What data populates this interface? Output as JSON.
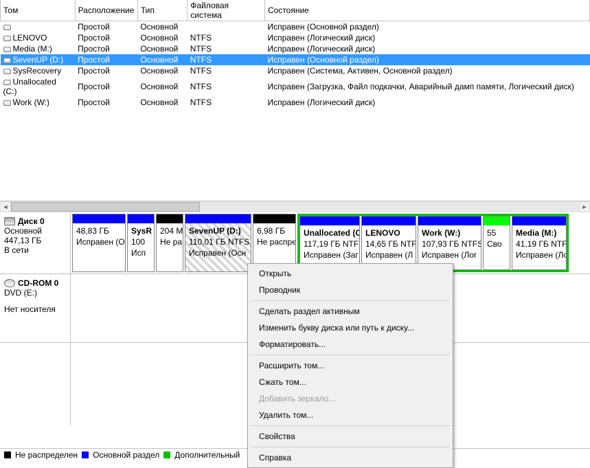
{
  "columns": [
    "Том",
    "Расположение",
    "Тип",
    "Файловая система",
    "Состояние"
  ],
  "volumes": [
    {
      "name": "",
      "layout": "Простой",
      "type": "Основной",
      "fs": "",
      "status": "Исправен (Основной раздел)",
      "sel": false
    },
    {
      "name": "LENOVO",
      "layout": "Простой",
      "type": "Основной",
      "fs": "NTFS",
      "status": "Исправен (Логический диск)",
      "sel": false
    },
    {
      "name": "Media (M:)",
      "layout": "Простой",
      "type": "Основной",
      "fs": "NTFS",
      "status": "Исправен (Логический диск)",
      "sel": false
    },
    {
      "name": "SevenUP (D:)",
      "layout": "Простой",
      "type": "Основной",
      "fs": "NTFS",
      "status": "Исправен (Основной раздел)",
      "sel": true
    },
    {
      "name": "SysRecovery",
      "layout": "Простой",
      "type": "Основной",
      "fs": "NTFS",
      "status": "Исправен (Система, Активен, Основной раздел)",
      "sel": false
    },
    {
      "name": "Unallocated (C:)",
      "layout": "Простой",
      "type": "Основной",
      "fs": "NTFS",
      "status": "Исправен (Загрузка, Файл подкачки, Аварийный дамп памяти, Логический диск)",
      "sel": false
    },
    {
      "name": "Work (W:)",
      "layout": "Простой",
      "type": "Основной",
      "fs": "NTFS",
      "status": "Исправен (Логический диск)",
      "sel": false
    }
  ],
  "disk0": {
    "title": "Диск 0",
    "type": "Основной",
    "size": "447,13 ГБ",
    "state": "В сети",
    "primaries": [
      {
        "w": 78,
        "cap": "#0000ff",
        "title": "",
        "size": "48,83 ГБ",
        "status": "Исправен (Ос"
      },
      {
        "w": 40,
        "cap": "#0000ff",
        "title": "SysR",
        "size": "100",
        "status": "Исп"
      },
      {
        "w": 40,
        "cap": "#000000",
        "title": "",
        "size": "204 М",
        "status": "Не ра"
      },
      {
        "w": 97,
        "cap": "#0000ff",
        "title": "SevenUP  (D:)",
        "size": "110,01 ГБ NTFS",
        "status": "Исправен (Осн",
        "hatch": true
      },
      {
        "w": 63,
        "cap": "#000000",
        "title": "",
        "size": "6,98 ГБ",
        "status": "Не распред"
      }
    ],
    "logicals": [
      {
        "w": 88,
        "cap": "#0000ff",
        "title": "Unallocated  (C",
        "size": "117,19 ГБ NTFS",
        "status": "Исправен (Заг"
      },
      {
        "w": 80,
        "cap": "#0000ff",
        "title": "LENOVO",
        "size": "14,65 ГБ NTF",
        "status": "Исправен (Л"
      },
      {
        "w": 93,
        "cap": "#0000ff",
        "title": "Work  (W:)",
        "size": "107,93 ГБ NTFS",
        "status": "Исправен (Лог"
      },
      {
        "w": 30,
        "cap": "#00ff00",
        "title": "",
        "size": "55 ",
        "status": "Сво"
      },
      {
        "w": 80,
        "cap": "#0000ff",
        "title": "Media  (M:)",
        "size": "41,19 ГБ NTFS",
        "status": "Исправен (Ло"
      }
    ]
  },
  "cdrom": {
    "title": "CD-ROM 0",
    "type": "DVD (E:)",
    "state": "Нет носителя"
  },
  "legend": {
    "unalloc": "Не распределен",
    "primary": "Основной раздел",
    "ext": "Дополнительный"
  },
  "menu": [
    {
      "label": "Открыть",
      "en": true
    },
    {
      "label": "Проводник",
      "en": true
    },
    {
      "sep": true
    },
    {
      "label": "Сделать раздел активным",
      "en": true
    },
    {
      "label": "Изменить букву диска или путь к диску...",
      "en": true
    },
    {
      "label": "Форматировать...",
      "en": true
    },
    {
      "sep": true
    },
    {
      "label": "Расширить том...",
      "en": true
    },
    {
      "label": "Сжать том...",
      "en": true
    },
    {
      "label": "Добавить зеркало...",
      "en": false
    },
    {
      "label": "Удалить том...",
      "en": true
    },
    {
      "sep": true
    },
    {
      "label": "Свойства",
      "en": true
    },
    {
      "sep": true
    },
    {
      "label": "Справка",
      "en": true
    }
  ]
}
